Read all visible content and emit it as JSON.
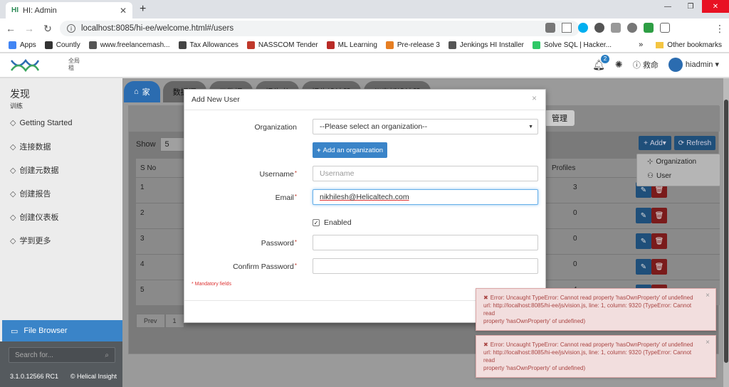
{
  "browser": {
    "tab_title": "HI: Admin",
    "tab_favicon": "HI",
    "url": "localhost:8085/hi-ee/welcome.html#/users",
    "bookmarks": [
      {
        "label": "Apps",
        "icon": "apps-grid-icon",
        "color": "#4285f4"
      },
      {
        "label": "Countly",
        "icon": "countly-icon",
        "color": "#333333"
      },
      {
        "label": "www.freelancemash...",
        "icon": "freelance-icon",
        "color": "#555555"
      },
      {
        "label": "Tax Allowances",
        "icon": "tax-icon",
        "color": "#444444"
      },
      {
        "label": "NASSCOM Tender",
        "icon": "nasscom-icon",
        "color": "#c0392b"
      },
      {
        "label": "ML Learning",
        "icon": "quora-icon",
        "color": "#b92b27"
      },
      {
        "label": "Pre-release 3",
        "icon": "package-icon",
        "color": "#e67e22"
      },
      {
        "label": "Jenkings HI Installer",
        "icon": "jenkins-icon",
        "color": "#555555"
      },
      {
        "label": "Solve SQL | Hacker...",
        "icon": "hackerrank-icon",
        "color": "#2ec866"
      }
    ],
    "other_bookmarks": "Other bookmarks",
    "more": "»"
  },
  "header": {
    "org_lines": [
      "全局",
      "租"
    ],
    "notif_count": "2",
    "help_label": "救命",
    "user_name": "hiadmin"
  },
  "sidebar": {
    "title": "发现",
    "subtitle": "训练",
    "items": [
      {
        "label": "Getting Started"
      },
      {
        "label": "连接数据"
      },
      {
        "label": "创建元数据"
      },
      {
        "label": "创建报告"
      },
      {
        "label": "创建仪表板"
      },
      {
        "label": "学到更多"
      }
    ],
    "file_browser": "File Browser",
    "search_placeholder": "Search for...",
    "version": "3.1.0.12566 RC1",
    "copyright": "© Helical Insight"
  },
  "main": {
    "home_tab": "家",
    "tabs": [
      "数据源",
      "元数据",
      "报告书",
      "报告设计器",
      "仪表板设计器"
    ],
    "manage": "管理",
    "show_label": "Show",
    "show_value": "5",
    "add_btn": "Add",
    "refresh_btn": "Refresh",
    "col_sno": "S No",
    "col_profiles": "Profiles",
    "rows": [
      {
        "sno": "1",
        "profiles": "3"
      },
      {
        "sno": "2",
        "profiles": "0"
      },
      {
        "sno": "3",
        "profiles": "0"
      },
      {
        "sno": "4",
        "profiles": "0"
      },
      {
        "sno": "5",
        "profiles": "4"
      }
    ],
    "pager": [
      "Prev",
      "1"
    ],
    "add_menu": [
      "Organization",
      "User"
    ]
  },
  "modal": {
    "title": "Add New User",
    "org_label": "Organization",
    "org_value": "--Please select an organization--",
    "add_org_btn": "Add an organization",
    "username_label": "Username",
    "username_placeholder": "Username",
    "email_label": "Email",
    "email_value": "nikhilesh@Helicaltech.com",
    "enabled_label": "Enabled",
    "password_label": "Password",
    "confirm_label": "Confirm Password",
    "required_mark": "*",
    "mandatory_note": "* Mandatory fields"
  },
  "toasts": [
    {
      "line1": "Error: Uncaught TypeError: Cannot read property 'hasOwnProperty' of undefined",
      "line2": "url: http://localhost:8085/hi-ee/js/vision.js, line: 1, column: 9320 (TypeError: Cannot read",
      "line3": "property 'hasOwnProperty' of undefined)"
    },
    {
      "line1": "Error: Uncaught TypeError: Cannot read property 'hasOwnProperty' of undefined",
      "line2": "url: http://localhost:8085/hi-ee/js/vision.js, line: 1, column: 9320 (TypeError: Cannot read",
      "line3": "property 'hasOwnProperty' of undefined)"
    }
  ],
  "colors": {
    "accent": "#3a84c8",
    "error_bg": "#f2dede",
    "error_text": "#a94442"
  }
}
